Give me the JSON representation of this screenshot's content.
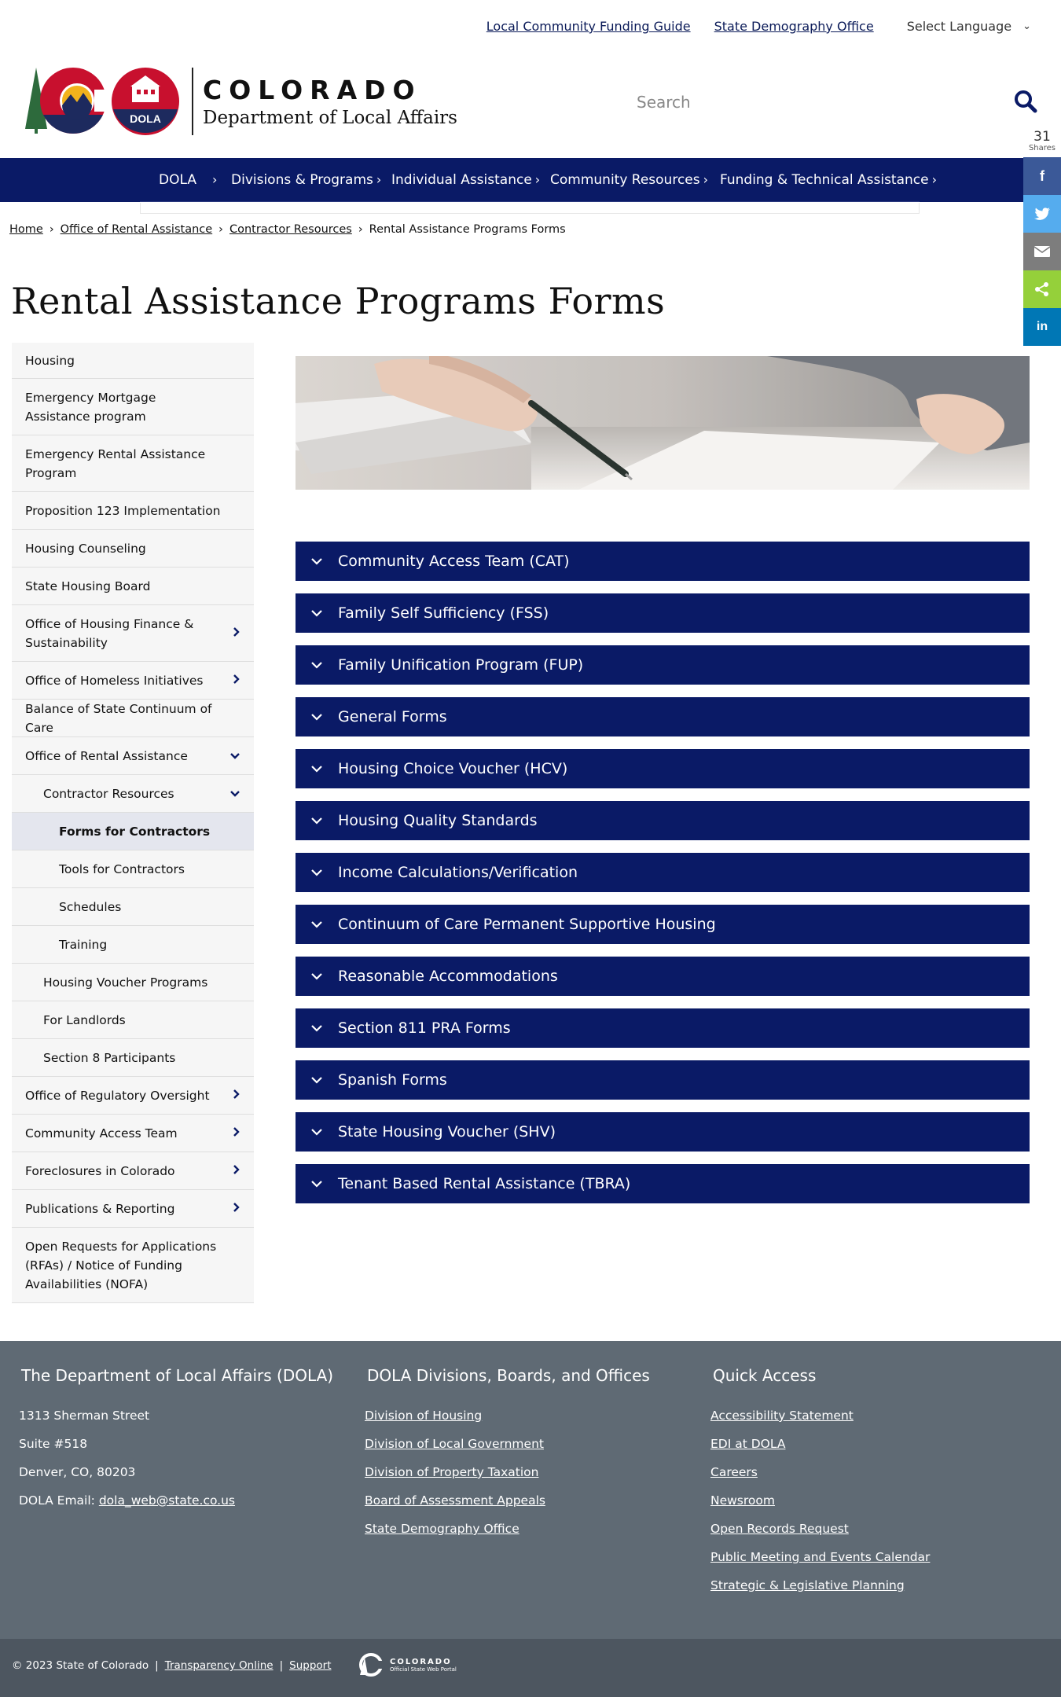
{
  "utility": {
    "links": [
      "Local Community Funding Guide",
      "State Demography Office"
    ],
    "language_label": "Select Language"
  },
  "header": {
    "state_name": "COLORADO",
    "agency_name": "Department of Local Affairs",
    "logo_badge": "DOLA",
    "search_placeholder": "Search"
  },
  "share": {
    "count": "31",
    "label": "Shares",
    "buttons": [
      {
        "icon": "facebook-icon",
        "glyph": "f",
        "color": "#3b5998"
      },
      {
        "icon": "twitter-icon",
        "glyph": "🐦",
        "color": "#55acee"
      },
      {
        "icon": "email-icon",
        "glyph": "✉",
        "color": "#7d7d7d"
      },
      {
        "icon": "share-icon",
        "glyph": "<",
        "color": "#95d03a"
      },
      {
        "icon": "linkedin-icon",
        "glyph": "in",
        "color": "#0077b5"
      }
    ]
  },
  "nav": {
    "items": [
      "DOLA",
      "Divisions & Programs",
      "Individual Assistance",
      "Community Resources",
      "Funding & Technical Assistance"
    ]
  },
  "breadcrumb": {
    "items": [
      "Home",
      "Office of Rental Assistance",
      "Contractor Resources"
    ],
    "current": "Rental Assistance Programs Forms"
  },
  "page_title": "Rental Assistance Programs Forms",
  "sidebar": {
    "items": [
      {
        "label": "Housing",
        "level": 1,
        "chevron": ""
      },
      {
        "label": "Emergency Mortgage Assistance program",
        "level": 1,
        "chevron": ""
      },
      {
        "label": "Emergency Rental Assistance Program",
        "level": 1,
        "chevron": ""
      },
      {
        "label": "Proposition 123 Implementation",
        "level": 1,
        "chevron": ""
      },
      {
        "label": "Housing Counseling",
        "level": 1,
        "chevron": ""
      },
      {
        "label": "State Housing Board",
        "level": 1,
        "chevron": ""
      },
      {
        "label": "Office of Housing Finance & Sustainability",
        "level": 1,
        "chevron": "right"
      },
      {
        "label": "Office of Homeless Initiatives",
        "level": 1,
        "chevron": "right"
      },
      {
        "label": "Balance of State Continuum of Care",
        "level": 1,
        "chevron": ""
      },
      {
        "label": "Office of Rental Assistance",
        "level": 1,
        "chevron": "down"
      },
      {
        "label": "Contractor Resources",
        "level": 2,
        "chevron": "down"
      },
      {
        "label": "Forms for Contractors",
        "level": 3,
        "chevron": "",
        "active": true
      },
      {
        "label": "Tools for Contractors",
        "level": 3,
        "chevron": ""
      },
      {
        "label": "Schedules",
        "level": 3,
        "chevron": ""
      },
      {
        "label": "Training",
        "level": 3,
        "chevron": ""
      },
      {
        "label": "Housing Voucher Programs",
        "level": 2,
        "chevron": ""
      },
      {
        "label": "For Landlords",
        "level": 2,
        "chevron": ""
      },
      {
        "label": "Section 8 Participants",
        "level": 2,
        "chevron": ""
      },
      {
        "label": "Office of Regulatory Oversight",
        "level": 1,
        "chevron": "right"
      },
      {
        "label": "Community Access Team",
        "level": 1,
        "chevron": "right"
      },
      {
        "label": "Foreclosures in Colorado",
        "level": 1,
        "chevron": "right"
      },
      {
        "label": "Publications & Reporting",
        "level": 1,
        "chevron": "right"
      },
      {
        "label": "Open Requests for Applications (RFAs) / Notice of Funding Availabilities (NOFA)",
        "level": 1,
        "chevron": ""
      }
    ]
  },
  "accordion": {
    "items": [
      "Community Access Team (CAT)",
      "Family Self Sufficiency (FSS)",
      "Family Unification Program (FUP)",
      "General Forms",
      "Housing Choice Voucher (HCV)",
      "Housing Quality Standards",
      "Income Calculations/Verification",
      "Continuum of Care Permanent Supportive Housing",
      "Reasonable Accommodations",
      "Section 811 PRA Forms",
      "Spanish Forms",
      "State Housing Voucher (SHV)",
      "Tenant Based Rental Assistance (TBRA)"
    ]
  },
  "footer": {
    "col1": {
      "title": "The Department of Local Affairs (DOLA)",
      "lines": [
        "1313 Sherman Street",
        "Suite  #518",
        "Denver, CO, 80203"
      ],
      "email_label": "DOLA Email:",
      "email": "dola_web@state.co.us"
    },
    "col2": {
      "title": "DOLA Divisions, Boards, and Offices",
      "links": [
        "Division of Housing",
        "Division of Local Government",
        "Division of Property Taxation",
        "Board of Assessment Appeals",
        "State Demography Office"
      ]
    },
    "col3": {
      "title": "Quick Access",
      "links": [
        "Accessibility Statement",
        "EDI at DOLA",
        "Careers",
        "Newsroom",
        "Open Records Request",
        "Public Meeting and Events Calendar",
        "Strategic & Legislative Planning"
      ]
    },
    "bottom": {
      "copyright": "© 2023 State of Colorado",
      "links": [
        "Transparency Online",
        "Support"
      ],
      "portal_name": "COLORADO",
      "portal_tagline": "Official State Web Portal"
    }
  },
  "colors": {
    "navy": "#0a1a66",
    "footer": "#5f6a74",
    "footer_bar": "#4d5660"
  }
}
